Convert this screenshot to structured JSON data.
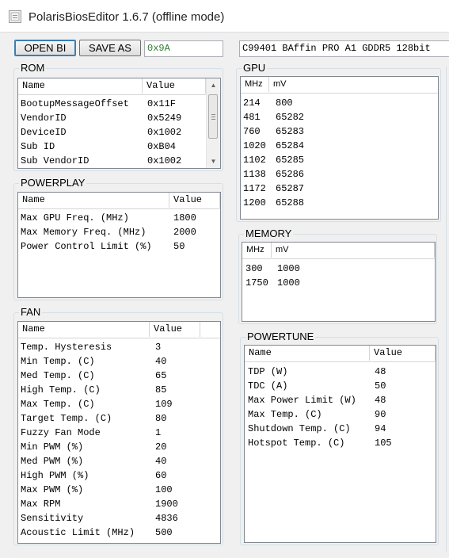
{
  "window": {
    "title": "PolarisBiosEditor 1.6.7 (offline mode)"
  },
  "toolbar": {
    "open_label": "OPEN BI",
    "saveas_label": "SAVE AS",
    "checksum_value": "0x9A",
    "bios_name_value": "C99401 BAffin PRO A1 GDDR5 128bit"
  },
  "colors": {
    "checksum_text": "#2e7d32",
    "group_border": "#d5dfe5",
    "list_border": "#828790"
  },
  "rom": {
    "legend": "ROM",
    "columns": [
      "Name",
      "Value"
    ],
    "rows": [
      [
        "BootupMessageOffset",
        "0x11F"
      ],
      [
        "VendorID",
        "0x5249"
      ],
      [
        "DeviceID",
        "0x1002"
      ],
      [
        "Sub ID",
        "0xB04"
      ],
      [
        "Sub VendorID",
        "0x1002"
      ]
    ]
  },
  "powerplay": {
    "legend": "POWERPLAY",
    "columns": [
      "Name",
      "Value"
    ],
    "rows": [
      [
        "Max GPU Freq. (MHz)",
        "1800"
      ],
      [
        "Max Memory Freq. (MHz)",
        "2000"
      ],
      [
        "Power Control Limit (%)",
        "50"
      ]
    ]
  },
  "fan": {
    "legend": "FAN",
    "columns": [
      "Name",
      "Value"
    ],
    "rows": [
      [
        "Temp. Hysteresis",
        "3"
      ],
      [
        "Min Temp. (C)",
        "40"
      ],
      [
        "Med Temp. (C)",
        "65"
      ],
      [
        "High Temp. (C)",
        "85"
      ],
      [
        "Max Temp. (C)",
        "109"
      ],
      [
        "Target Temp. (C)",
        "80"
      ],
      [
        "Fuzzy Fan Mode",
        "1"
      ],
      [
        "Min PWM (%)",
        "20"
      ],
      [
        "Med PWM (%)",
        "40"
      ],
      [
        "High PWM (%)",
        "60"
      ],
      [
        "Max PWM (%)",
        "100"
      ],
      [
        "Max RPM",
        "1900"
      ],
      [
        "Sensitivity",
        "4836"
      ],
      [
        "Acoustic Limit (MHz)",
        "500"
      ]
    ]
  },
  "gpu": {
    "legend": "GPU",
    "columns": [
      "MHz",
      "mV"
    ],
    "rows": [
      [
        "214",
        "800"
      ],
      [
        "481",
        "65282"
      ],
      [
        "760",
        "65283"
      ],
      [
        "1020",
        "65284"
      ],
      [
        "1102",
        "65285"
      ],
      [
        "1138",
        "65286"
      ],
      [
        "1172",
        "65287"
      ],
      [
        "1200",
        "65288"
      ]
    ]
  },
  "memory": {
    "legend": "MEMORY",
    "columns": [
      "MHz",
      "mV"
    ],
    "rows": [
      [
        "300",
        "1000"
      ],
      [
        "1750",
        "1000"
      ]
    ]
  },
  "powertune": {
    "legend": "POWERTUNE",
    "columns": [
      "Name",
      "Value"
    ],
    "rows": [
      [
        "TDP (W)",
        "48"
      ],
      [
        "TDC (A)",
        "50"
      ],
      [
        "Max Power Limit (W)",
        "48"
      ],
      [
        "Max Temp. (C)",
        "90"
      ],
      [
        "Shutdown Temp. (C)",
        "94"
      ],
      [
        "Hotspot Temp. (C)",
        "105"
      ]
    ]
  }
}
